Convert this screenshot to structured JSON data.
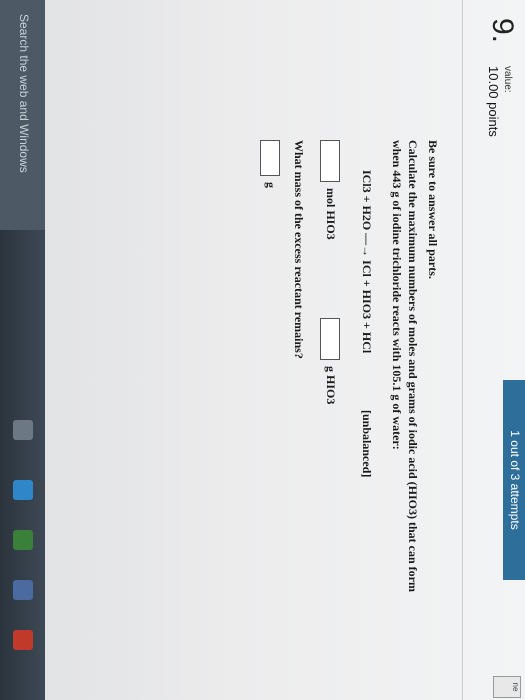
{
  "question": {
    "number": "9.",
    "value_label": "value:",
    "points": "10.00 points"
  },
  "attempts_label": "1 out of 3 attempts",
  "instructions": "Be sure to answer all parts.",
  "prompt_line1": "Calculate the maximum numbers of moles and grams of iodic acid (HIO3) that can form",
  "prompt_line2": "when 443 g of iodine trichloride reacts with 105.1 g of water:",
  "equation": "ICl3 + H2O —→ ICl + HIO3 + HCl",
  "equation_note": "[unbalanced]",
  "answers": {
    "mol_unit": "mol HIO3",
    "g_unit": "g HIO3",
    "excess_question": "What mass of the excess reactant remains?",
    "excess_unit": "g"
  },
  "taskbar": {
    "search_placeholder": "Search the web and Windows"
  },
  "corner_label": "ne"
}
